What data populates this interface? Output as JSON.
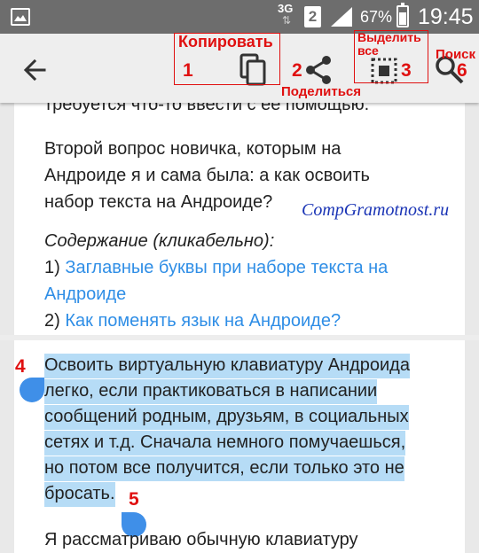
{
  "status_bar": {
    "network": "3G",
    "sim": "2",
    "battery_percent": "67%",
    "time": "19:45",
    "icons": [
      "gallery-icon",
      "signal-icon",
      "battery-icon"
    ]
  },
  "action_bar": {
    "icons": [
      "back-arrow-icon",
      "copy-icon",
      "share-icon",
      "select-all-icon",
      "search-icon"
    ]
  },
  "annotations": {
    "copy_label": "Копировать",
    "copy_num": "1",
    "share_num": "2",
    "share_label": "Поделиться",
    "selectall_label": "Выделить все",
    "selectall_num": "3",
    "search_label": "Поиск",
    "search_num": "6",
    "handle_left_num": "4",
    "handle_right_num": "5",
    "color": "#e01010"
  },
  "watermark": "CompGramotnost.ru",
  "article": {
    "cut_line": "требуется что-то ввести с ее помощью.",
    "para2_lines": [
      "Второй вопрос новичка, которым на",
      "Андроиде я и сама была: а как освоить",
      "набор текста на Андроиде?"
    ],
    "toc_title": "Содержание (кликабельно):",
    "toc": [
      {
        "num": "1)",
        "lines": [
          "Заглавные буквы при наборе текста на",
          "Андроиде"
        ]
      },
      {
        "num": "2)",
        "lines": [
          "Как поменять язык на Андроиде?"
        ]
      }
    ],
    "selected_lines": [
      "Освоить виртуальную клавиатуру Андроида",
      "легко, если практиковаться в написании",
      "сообщений родным, друзьям, в социальных",
      "сетях и т.д. Сначала немного помучаешься,",
      "но потом все получится, если только это не",
      "бросать."
    ],
    "bottom_line": "Я рассматриваю обычную клавиатуру"
  },
  "colors": {
    "selection": "#b6dcf6",
    "handle": "#3f8fe8",
    "link": "#2f8ee6",
    "watermark": "#1a34b5"
  }
}
